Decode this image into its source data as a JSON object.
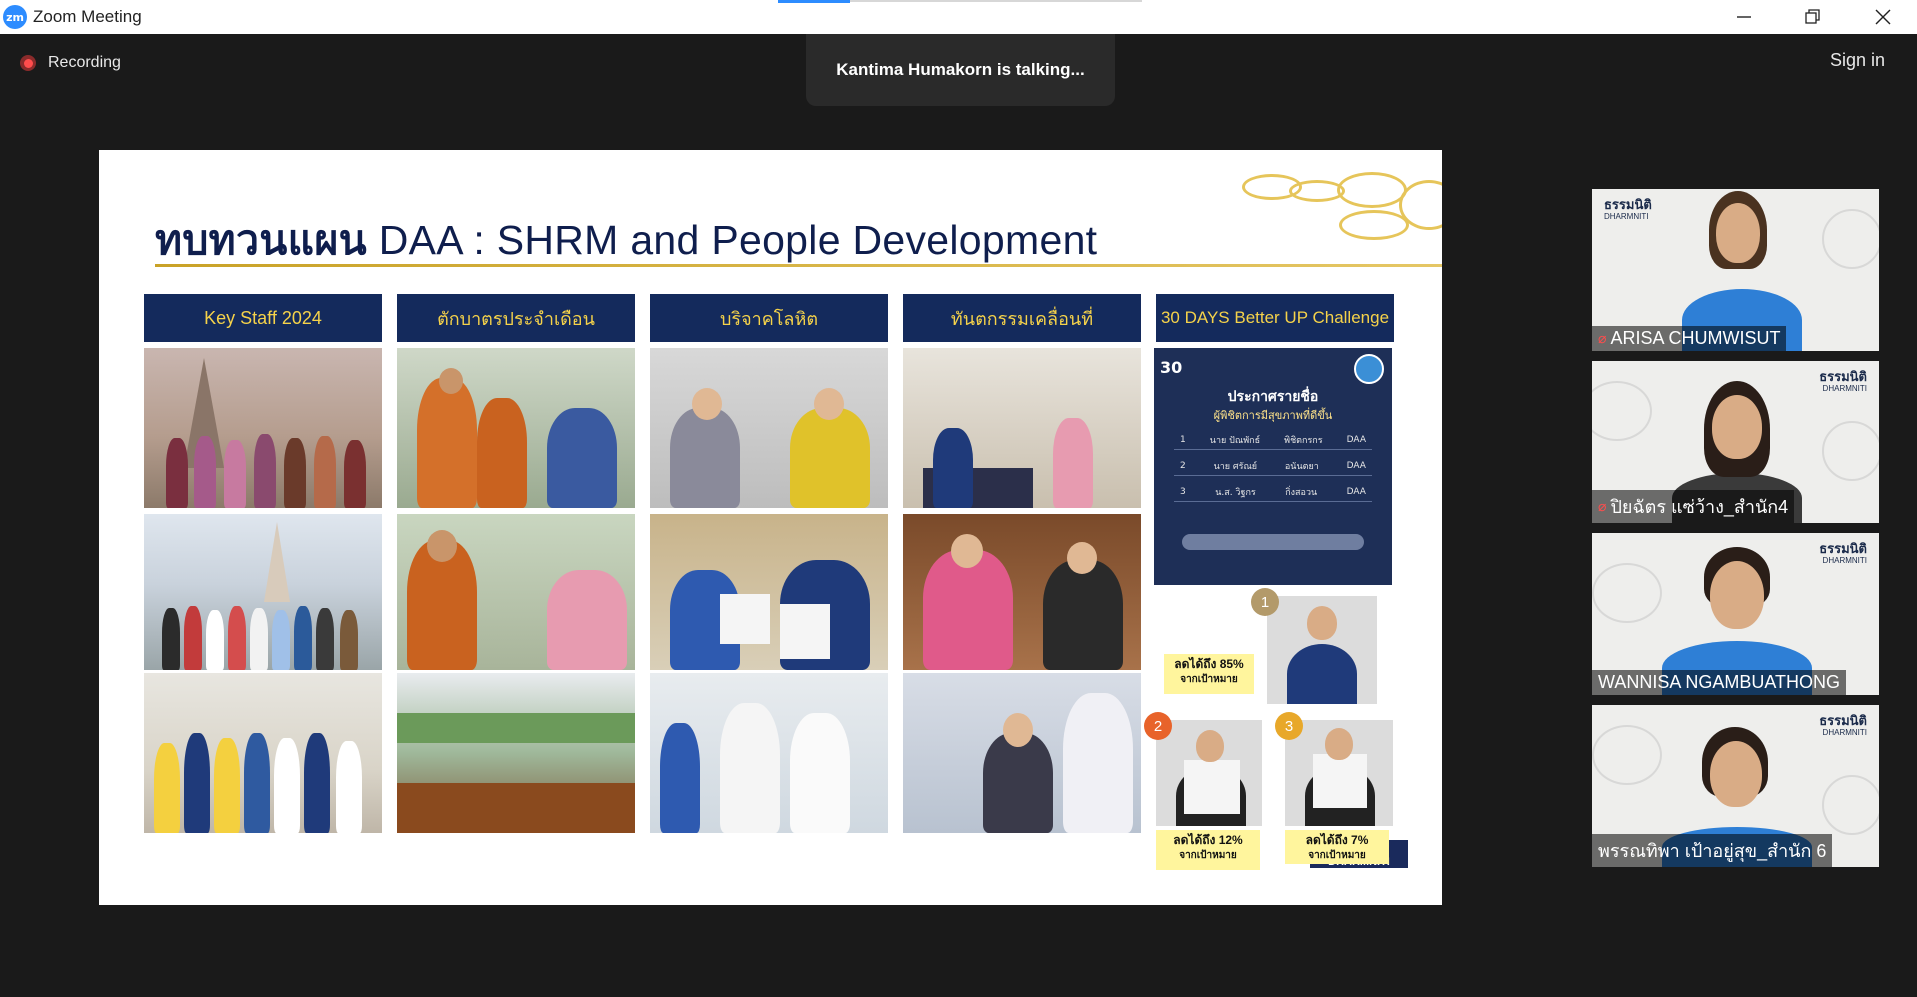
{
  "window": {
    "app_logo": "zm",
    "title": "Zoom Meeting"
  },
  "controls": {
    "minimize": "minimize-icon",
    "restore": "restore-icon",
    "close": "close-icon"
  },
  "meeting": {
    "recording_label": "Recording",
    "talking_indicator": "Kantima Humakorn is talking...",
    "sign_in_label": "Sign in"
  },
  "slide": {
    "title_thai": "ทบทวนแผน",
    "title_en": " DAA : SHRM and People Development",
    "columns": [
      {
        "header": "Key Staff 2024"
      },
      {
        "header": "ตักบาตรประจำเดือน"
      },
      {
        "header": "บริจาคโลหิต"
      },
      {
        "header": "ทันตกรรมเคลื่อนที่"
      },
      {
        "header": "30 DAYS Better UP Challenge"
      }
    ],
    "poster": {
      "logo_text": "30",
      "title": "ประกาศรายชื่อ",
      "subtitle": "ผู้พิชิตการมีสุขภาพที่ดีขึ้น",
      "rows": [
        {
          "rank": "1",
          "name": "นาย ปัณพักธ์",
          "surname": "พิชิตกรกร",
          "dept": "DAA"
        },
        {
          "rank": "2",
          "name": "นาย ศรัณย์",
          "surname": "อนันตยา",
          "dept": "DAA"
        },
        {
          "rank": "3",
          "name": "น.ส. วิฐกร",
          "surname": "กิ่งสอวน",
          "dept": "DAA"
        }
      ]
    },
    "winners": [
      {
        "badge": "1",
        "note_line1": "ลดได้ถึง 85%",
        "note_line2": "จากเป้าหมาย"
      },
      {
        "badge": "2",
        "note_line1": "ลดได้ถึง 12%",
        "note_line2": "จากเป้าหมาย"
      },
      {
        "badge": "3",
        "note_line1": "ลดได้ถึง 7%",
        "note_line2": "จากเป้าหมาย"
      }
    ],
    "footer_logo": "DHARMNITI"
  },
  "participants": [
    {
      "name": "ARISA CHUMWISUT",
      "muted": true
    },
    {
      "name": "ปิยฉัตร แซ่ว้าง_สำนัก4",
      "muted": true
    },
    {
      "name": "WANNISA NGAMBUATHONG",
      "muted": false
    },
    {
      "name": "พรรณทิพา  เป้าอยู่สุข_สำนัก 6",
      "muted": false
    }
  ],
  "brand": {
    "thai": "ธรรมนิติ",
    "en": "DHARMNITI"
  }
}
